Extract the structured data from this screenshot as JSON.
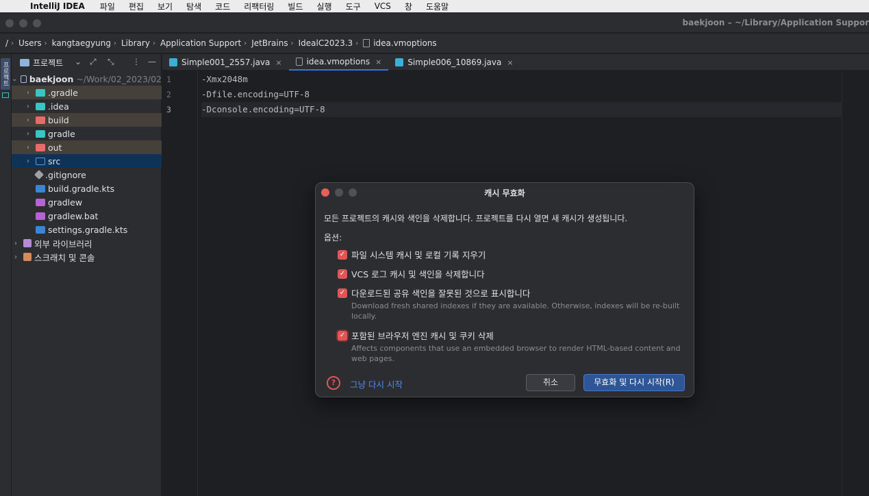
{
  "menubar": {
    "app_name": "IntelliJ IDEA",
    "items": [
      "파일",
      "편집",
      "보기",
      "탐색",
      "코드",
      "리팩터링",
      "빌드",
      "실행",
      "도구",
      "VCS",
      "창",
      "도움말"
    ]
  },
  "window": {
    "title": "baekjoon – ~/Library/Application Suppor"
  },
  "breadcrumb": {
    "root": "/",
    "items": [
      "Users",
      "kangtaegyung",
      "Library",
      "Application Support",
      "JetBrains",
      "IdealC2023.3"
    ],
    "file": "idea.vmoptions"
  },
  "toolstrip": {
    "project_tab": "프로젝트"
  },
  "project": {
    "title": "프로젝트",
    "root": {
      "name": "baekjoon",
      "path": "~/Work/02_2023/02"
    },
    "items": [
      {
        "name": ".gradle",
        "icon_color": "#3bc4c4"
      },
      {
        "name": ".idea",
        "icon_color": "#3bc4c4"
      },
      {
        "name": "build",
        "icon_color": "#e86b6b"
      },
      {
        "name": "gradle",
        "icon_color": "#3bc4c4"
      },
      {
        "name": "out",
        "icon_color": "#e86b6b"
      },
      {
        "name": "src",
        "icon_color": "#5a9bd5"
      },
      {
        "name": ".gitignore",
        "icon_color": "#9da0a8"
      },
      {
        "name": "build.gradle.kts",
        "icon_color": "#3a85d4"
      },
      {
        "name": "gradlew",
        "icon_color": "#b763d1"
      },
      {
        "name": "gradlew.bat",
        "icon_color": "#b763d1"
      },
      {
        "name": "settings.gradle.kts",
        "icon_color": "#3a85d4"
      }
    ],
    "external_libraries": "외부 라이브러리",
    "scratches": "스크래치 및 콘솔"
  },
  "editor": {
    "tabs": [
      {
        "label": "Simple001_2557.java",
        "icon_color": "#3bb0d6"
      },
      {
        "label": "idea.vmoptions",
        "icon_color": "#9da0a8"
      },
      {
        "label": "Simple006_10869.java",
        "icon_color": "#3bb0d6"
      }
    ],
    "line_numbers": [
      "1",
      "2",
      "3"
    ],
    "lines": [
      "-Xmx2048m",
      "-Dfile.encoding=UTF-8",
      "-Dconsole.encoding=UTF-8"
    ]
  },
  "dialog": {
    "title": "캐시 무효화",
    "description": "모든 프로젝트의 캐시와 색인을 삭제합니다. 프로젝트를 다시 열면 새 캐시가 생성됩니다.",
    "options_label": "옵션:",
    "options": [
      {
        "label": "파일 시스템 캐시 및 로컬 기록 지우기",
        "checked": true
      },
      {
        "label": "VCS 로그 캐시 및 색인을 삭제합니다",
        "checked": true
      },
      {
        "label": "다운로드된 공유 색인을 잘못된 것으로 표시합니다",
        "checked": true,
        "hint": "Download fresh shared indexes if they are available. Otherwise, indexes will be re-built locally."
      },
      {
        "label": "포함된 브라우저 엔진 캐시 및 쿠키 삭제",
        "checked": true,
        "hint": "Affects components that use an embedded browser to render HTML-based content and web pages."
      }
    ],
    "just_restart": "그냥 다시 시작",
    "cancel": "취소",
    "confirm": "무효화 및 다시 시작(R)"
  }
}
